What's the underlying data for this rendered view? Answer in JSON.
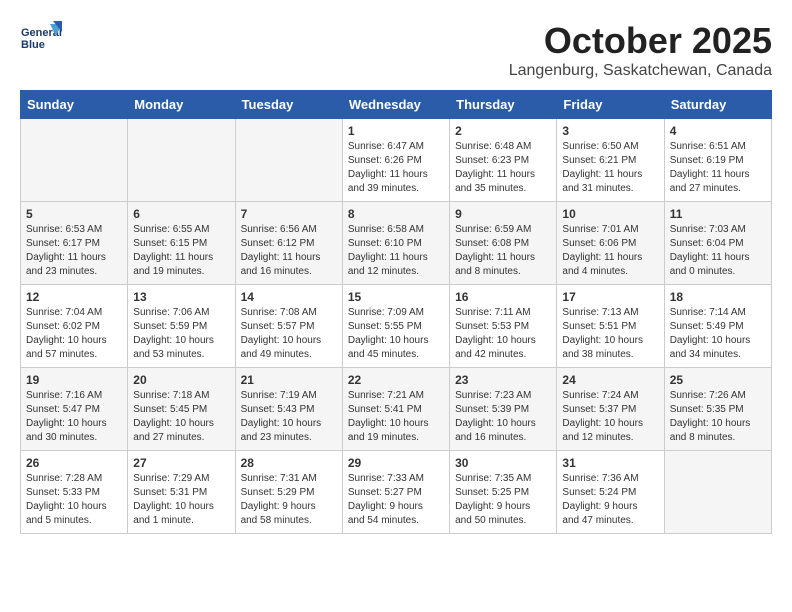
{
  "header": {
    "logo_line1": "General",
    "logo_line2": "Blue",
    "month": "October 2025",
    "location": "Langenburg, Saskatchewan, Canada"
  },
  "weekdays": [
    "Sunday",
    "Monday",
    "Tuesday",
    "Wednesday",
    "Thursday",
    "Friday",
    "Saturday"
  ],
  "weeks": [
    [
      {
        "day": "",
        "info": ""
      },
      {
        "day": "",
        "info": ""
      },
      {
        "day": "",
        "info": ""
      },
      {
        "day": "1",
        "info": "Sunrise: 6:47 AM\nSunset: 6:26 PM\nDaylight: 11 hours\nand 39 minutes."
      },
      {
        "day": "2",
        "info": "Sunrise: 6:48 AM\nSunset: 6:23 PM\nDaylight: 11 hours\nand 35 minutes."
      },
      {
        "day": "3",
        "info": "Sunrise: 6:50 AM\nSunset: 6:21 PM\nDaylight: 11 hours\nand 31 minutes."
      },
      {
        "day": "4",
        "info": "Sunrise: 6:51 AM\nSunset: 6:19 PM\nDaylight: 11 hours\nand 27 minutes."
      }
    ],
    [
      {
        "day": "5",
        "info": "Sunrise: 6:53 AM\nSunset: 6:17 PM\nDaylight: 11 hours\nand 23 minutes."
      },
      {
        "day": "6",
        "info": "Sunrise: 6:55 AM\nSunset: 6:15 PM\nDaylight: 11 hours\nand 19 minutes."
      },
      {
        "day": "7",
        "info": "Sunrise: 6:56 AM\nSunset: 6:12 PM\nDaylight: 11 hours\nand 16 minutes."
      },
      {
        "day": "8",
        "info": "Sunrise: 6:58 AM\nSunset: 6:10 PM\nDaylight: 11 hours\nand 12 minutes."
      },
      {
        "day": "9",
        "info": "Sunrise: 6:59 AM\nSunset: 6:08 PM\nDaylight: 11 hours\nand 8 minutes."
      },
      {
        "day": "10",
        "info": "Sunrise: 7:01 AM\nSunset: 6:06 PM\nDaylight: 11 hours\nand 4 minutes."
      },
      {
        "day": "11",
        "info": "Sunrise: 7:03 AM\nSunset: 6:04 PM\nDaylight: 11 hours\nand 0 minutes."
      }
    ],
    [
      {
        "day": "12",
        "info": "Sunrise: 7:04 AM\nSunset: 6:02 PM\nDaylight: 10 hours\nand 57 minutes."
      },
      {
        "day": "13",
        "info": "Sunrise: 7:06 AM\nSunset: 5:59 PM\nDaylight: 10 hours\nand 53 minutes."
      },
      {
        "day": "14",
        "info": "Sunrise: 7:08 AM\nSunset: 5:57 PM\nDaylight: 10 hours\nand 49 minutes."
      },
      {
        "day": "15",
        "info": "Sunrise: 7:09 AM\nSunset: 5:55 PM\nDaylight: 10 hours\nand 45 minutes."
      },
      {
        "day": "16",
        "info": "Sunrise: 7:11 AM\nSunset: 5:53 PM\nDaylight: 10 hours\nand 42 minutes."
      },
      {
        "day": "17",
        "info": "Sunrise: 7:13 AM\nSunset: 5:51 PM\nDaylight: 10 hours\nand 38 minutes."
      },
      {
        "day": "18",
        "info": "Sunrise: 7:14 AM\nSunset: 5:49 PM\nDaylight: 10 hours\nand 34 minutes."
      }
    ],
    [
      {
        "day": "19",
        "info": "Sunrise: 7:16 AM\nSunset: 5:47 PM\nDaylight: 10 hours\nand 30 minutes."
      },
      {
        "day": "20",
        "info": "Sunrise: 7:18 AM\nSunset: 5:45 PM\nDaylight: 10 hours\nand 27 minutes."
      },
      {
        "day": "21",
        "info": "Sunrise: 7:19 AM\nSunset: 5:43 PM\nDaylight: 10 hours\nand 23 minutes."
      },
      {
        "day": "22",
        "info": "Sunrise: 7:21 AM\nSunset: 5:41 PM\nDaylight: 10 hours\nand 19 minutes."
      },
      {
        "day": "23",
        "info": "Sunrise: 7:23 AM\nSunset: 5:39 PM\nDaylight: 10 hours\nand 16 minutes."
      },
      {
        "day": "24",
        "info": "Sunrise: 7:24 AM\nSunset: 5:37 PM\nDaylight: 10 hours\nand 12 minutes."
      },
      {
        "day": "25",
        "info": "Sunrise: 7:26 AM\nSunset: 5:35 PM\nDaylight: 10 hours\nand 8 minutes."
      }
    ],
    [
      {
        "day": "26",
        "info": "Sunrise: 7:28 AM\nSunset: 5:33 PM\nDaylight: 10 hours\nand 5 minutes."
      },
      {
        "day": "27",
        "info": "Sunrise: 7:29 AM\nSunset: 5:31 PM\nDaylight: 10 hours\nand 1 minute."
      },
      {
        "day": "28",
        "info": "Sunrise: 7:31 AM\nSunset: 5:29 PM\nDaylight: 9 hours\nand 58 minutes."
      },
      {
        "day": "29",
        "info": "Sunrise: 7:33 AM\nSunset: 5:27 PM\nDaylight: 9 hours\nand 54 minutes."
      },
      {
        "day": "30",
        "info": "Sunrise: 7:35 AM\nSunset: 5:25 PM\nDaylight: 9 hours\nand 50 minutes."
      },
      {
        "day": "31",
        "info": "Sunrise: 7:36 AM\nSunset: 5:24 PM\nDaylight: 9 hours\nand 47 minutes."
      },
      {
        "day": "",
        "info": ""
      }
    ]
  ]
}
